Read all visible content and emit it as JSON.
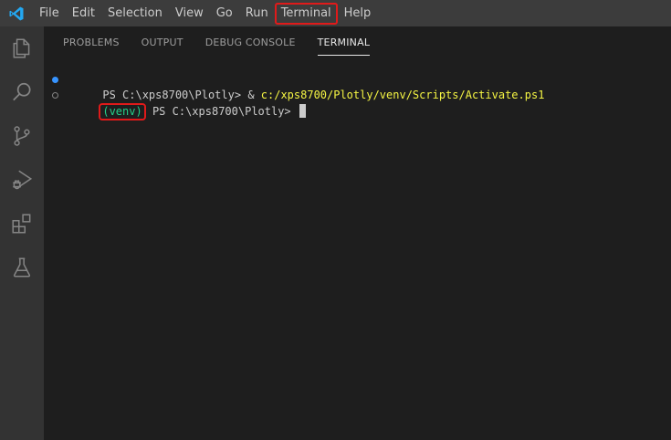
{
  "menu": {
    "items": [
      "File",
      "Edit",
      "Selection",
      "View",
      "Go",
      "Run",
      "Terminal",
      "Help"
    ]
  },
  "activity_bar": {
    "icons": [
      "explorer-icon",
      "search-icon",
      "source-control-icon",
      "run-debug-icon",
      "extensions-icon",
      "testing-icon"
    ]
  },
  "panel": {
    "tabs": [
      "PROBLEMS",
      "OUTPUT",
      "DEBUG CONSOLE",
      "TERMINAL"
    ],
    "active_tab": "TERMINAL"
  },
  "terminal": {
    "line1": {
      "prompt": "PS C:\\xps8700\\Plotly> ",
      "operator": "& ",
      "command": "c:/xps8700/Plotly/venv/Scripts/Activate.ps1"
    },
    "line2": {
      "venv": "(venv)",
      "prompt": " PS C:\\xps8700\\Plotly> "
    }
  },
  "colors": {
    "accent_blue": "#3794ff",
    "highlight_red": "#e01a1a",
    "command_yellow": "#f5f543",
    "venv_green": "#23d18b"
  }
}
